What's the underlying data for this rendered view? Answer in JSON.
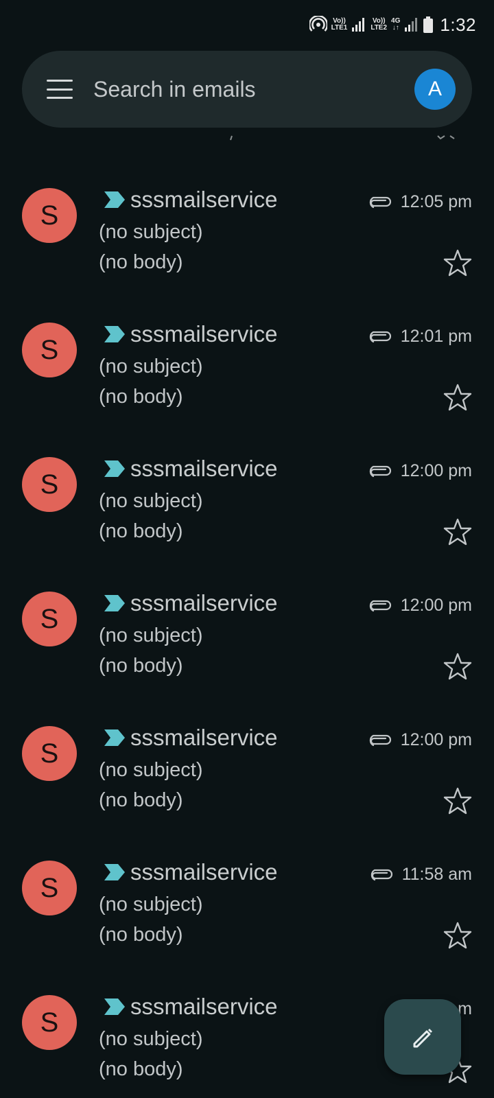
{
  "status_bar": {
    "sim1_top": "Vo))",
    "sim1_bottom": "LTE1",
    "sim2_top": "Vo))",
    "sim2_bottom": "LTE2",
    "network": "4G",
    "time": "1:32",
    "icons": [
      "hotspot-icon",
      "signal-icon",
      "signal-icon",
      "data-arrows-icon",
      "battery-icon"
    ]
  },
  "search": {
    "placeholder": "Search in emails",
    "account_initial": "A",
    "account_color": "#1a86d4"
  },
  "emails": [
    {
      "avatar": "S",
      "sender": "sssmailservice",
      "subject": "(no subject)",
      "snippet": "(no body)",
      "time": "12:05 pm",
      "has_attachment": true,
      "important": true,
      "starred": false
    },
    {
      "avatar": "S",
      "sender": "sssmailservice",
      "subject": "(no subject)",
      "snippet": "(no body)",
      "time": "12:01 pm",
      "has_attachment": true,
      "important": true,
      "starred": false
    },
    {
      "avatar": "S",
      "sender": "sssmailservice",
      "subject": "(no subject)",
      "snippet": "(no body)",
      "time": "12:00 pm",
      "has_attachment": true,
      "important": true,
      "starred": false
    },
    {
      "avatar": "S",
      "sender": "sssmailservice",
      "subject": "(no subject)",
      "snippet": "(no body)",
      "time": "12:00 pm",
      "has_attachment": true,
      "important": true,
      "starred": false
    },
    {
      "avatar": "S",
      "sender": "sssmailservice",
      "subject": "(no subject)",
      "snippet": "(no body)",
      "time": "12:00 pm",
      "has_attachment": true,
      "important": true,
      "starred": false
    },
    {
      "avatar": "S",
      "sender": "sssmailservice",
      "subject": "(no subject)",
      "snippet": "(no body)",
      "time": "11:58 am",
      "has_attachment": true,
      "important": true,
      "starred": false
    },
    {
      "avatar": "S",
      "sender": "sssmailservice",
      "subject": "(no subject)",
      "snippet": "(no body)",
      "time": "m",
      "has_attachment": true,
      "important": true,
      "starred": false
    }
  ],
  "colors": {
    "background": "#0b1315",
    "avatar_bg": "#e16459",
    "important_marker": "#5fc3cc",
    "fab_bg": "#2b4a4d"
  },
  "compose": {
    "icon": "pencil-icon"
  }
}
